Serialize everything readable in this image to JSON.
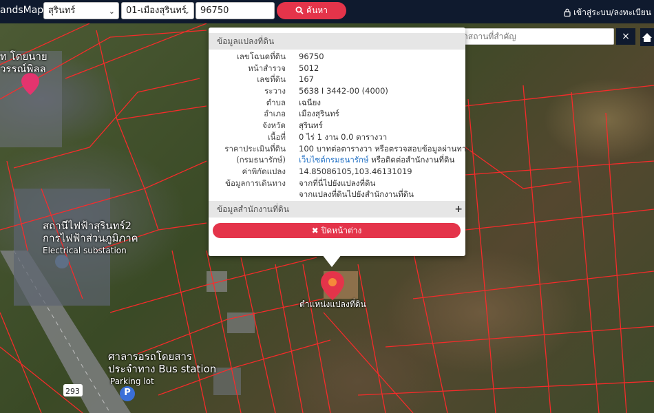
{
  "topbar": {
    "brand": "andsMaps",
    "province": "สุรินทร์",
    "district": "01-เมืองสุรินทร์",
    "deed_number": "96750",
    "search_label": "ค้นหา",
    "login_label": "เข้าสู่ระบบ/ลงทะเบียน"
  },
  "place_search": {
    "placeholder": "ค้นหาสถานที่สำคัญ",
    "close": "×"
  },
  "popup": {
    "section_parcel": "ข้อมูลแปลงที่ดิน",
    "rows": [
      {
        "label": "เลขโฉนดที่ดิน",
        "value": "96750"
      },
      {
        "label": "หน้าสำรวจ",
        "value": "5012"
      },
      {
        "label": "เลขที่ดิน",
        "value": "167"
      },
      {
        "label": "ระวาง",
        "value": "5638 I 3442-00 (4000)"
      },
      {
        "label": "ตำบล",
        "value": "เฉนียง"
      },
      {
        "label": "อำเภอ",
        "value": "เมืองสุรินทร์"
      },
      {
        "label": "จังหวัด",
        "value": "สุรินทร์"
      },
      {
        "label": "เนื้อที่",
        "value": "0 ไร่ 1 งาน 0.0 ตารางวา"
      },
      {
        "label": "ราคาประเมินที่ดิน",
        "value": "100 บาทต่อตารางวา หรือตรวจสอบข้อมูลผ่านทาง"
      },
      {
        "label": "(กรมธนารักษ์)",
        "value_link": "เว็บไซต์กรมธนารักษ์",
        "value_rest": " หรือติดต่อสำนักงานที่ดิน"
      },
      {
        "label": "ค่าพิกัดแปลง",
        "value_link": "14.85086105,103.46131019"
      },
      {
        "label": "ข้อมูลการเดินทาง",
        "value_link": "จากที่นี่ไปยังแปลงที่ดิน"
      },
      {
        "label": "",
        "value_link": "จากแปลงที่ดินไปยังสำนักงานที่ดิน"
      }
    ],
    "section_office": "ข้อมูลสำนักงานที่ดิน",
    "section_office_toggle": "+",
    "close_label": "ปิดหน้าต่าง"
  },
  "map": {
    "labels": {
      "top_left_1": "ท โดยนาย",
      "top_left_2": "วรรณ์พิลล",
      "substation_1": "สถานีไฟฟ้าสุรินทร์2",
      "substation_2": "การไฟฟ้าส่วนภูมิภาค",
      "substation_en": "Electrical substation",
      "bus_1": "ศาลารอรถโดยสาร",
      "bus_2": "ประจำทาง Bus station",
      "parking": "Parking lot",
      "road_no": "293",
      "parcel_marker": "ตำแหน่งแปลงที่ดิน"
    }
  },
  "colors": {
    "accent": "#e4344a",
    "navbar": "#0f1a2e",
    "link": "#1f6fc4",
    "parcel_line": "#ff2a2a"
  }
}
